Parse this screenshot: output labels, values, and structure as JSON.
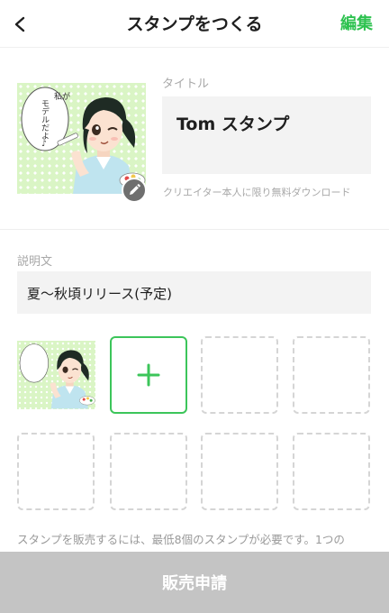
{
  "header": {
    "back_icon": "chevron-left-icon",
    "title": "スタンプをつくる",
    "edit_label": "編集",
    "accent_color": "#2ec250"
  },
  "cover": {
    "speech_bubble_text": "私が モデルだよ♪",
    "edit_icon": "pencil-icon"
  },
  "title_section": {
    "label": "タイトル",
    "value": "Tom スタンプ",
    "note": "クリエイター本人に限り無料ダウンロード"
  },
  "description_section": {
    "label": "説明文",
    "value": "夏～秋頃リリース(予定)"
  },
  "stickers": {
    "slots": [
      "sticker",
      "add",
      "empty",
      "empty",
      "empty",
      "empty",
      "empty",
      "empty"
    ],
    "add_icon": "plus-icon",
    "add_color": "#3cc55a"
  },
  "notice": "スタンプを販売するには、最低8個のスタンプが必要です。1つの",
  "sale_button": {
    "label": "販売申請",
    "background": "#c4c4c4"
  }
}
